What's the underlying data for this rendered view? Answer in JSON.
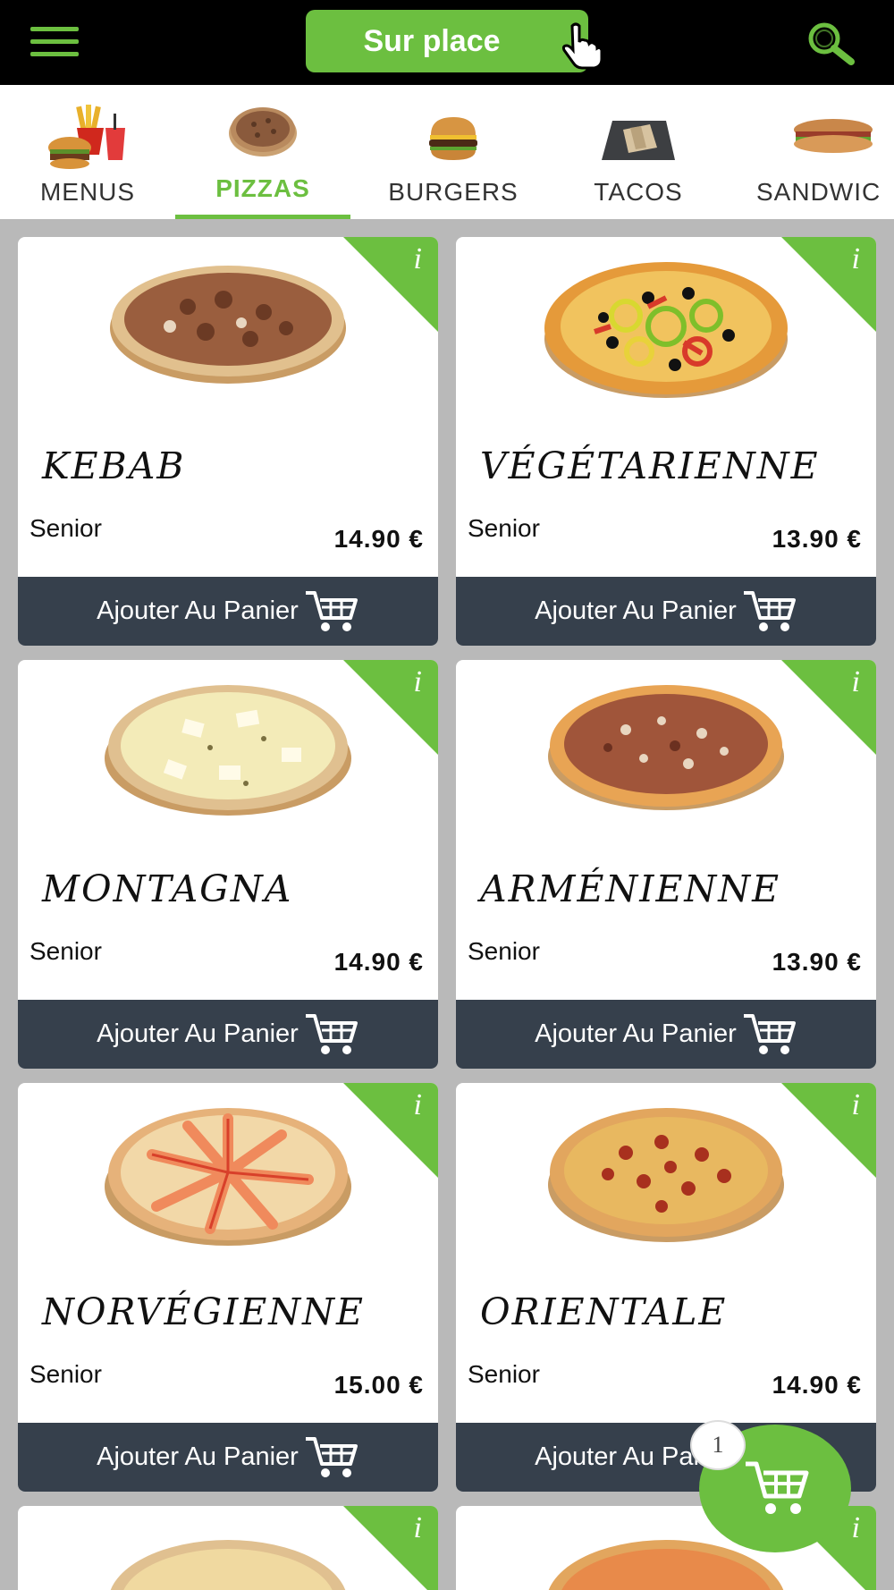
{
  "topbar": {
    "menu_icon": "hamburger-icon",
    "mode_label": "Sur place",
    "search_icon": "search-icon"
  },
  "categories": [
    {
      "label": "MENUS",
      "active": false
    },
    {
      "label": "PIZZAS",
      "active": true
    },
    {
      "label": "BURGERS",
      "active": false
    },
    {
      "label": "TACOS",
      "active": false
    },
    {
      "label": "SANDWIC",
      "active": false
    }
  ],
  "products": [
    {
      "name": "KEBAB",
      "size": "Senior",
      "price": "14.90 €",
      "add_label": "Ajouter Au Panier"
    },
    {
      "name": "VÉGÉTARIENNE",
      "size": "Senior",
      "price": "13.90 €",
      "add_label": "Ajouter Au Panier"
    },
    {
      "name": "MONTAGNA",
      "size": "Senior",
      "price": "14.90 €",
      "add_label": "Ajouter Au Panier"
    },
    {
      "name": "ARMÉNIENNE",
      "size": "Senior",
      "price": "13.90 €",
      "add_label": "Ajouter Au Panier"
    },
    {
      "name": "NORVÉGIENNE",
      "size": "Senior",
      "price": "15.00 €",
      "add_label": "Ajouter Au Panier"
    },
    {
      "name": "ORIENTALE",
      "size": "Senior",
      "price": "14.90 €",
      "add_label": "Ajouter Au Panier"
    }
  ],
  "info_icon_glyph": "i",
  "cart": {
    "count": "1"
  },
  "colors": {
    "accent": "#6cbf40",
    "button_dark": "#36404c",
    "background": "#b9b9b9"
  }
}
